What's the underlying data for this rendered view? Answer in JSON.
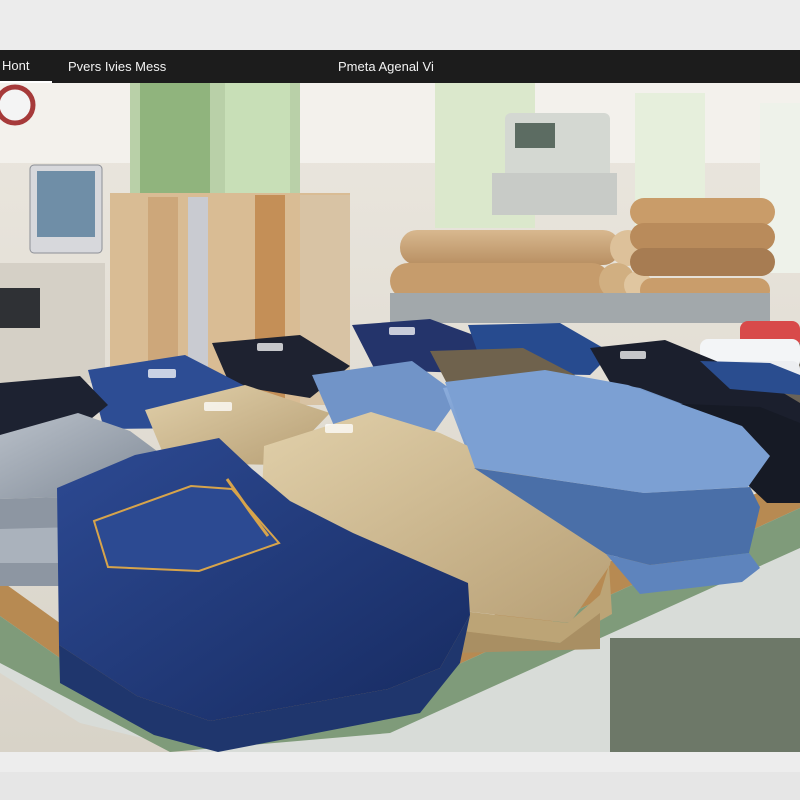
{
  "toolbar": {
    "tabs": [
      {
        "label": "Hont"
      },
      {
        "label": "Pvers Ivies Mess"
      },
      {
        "label": "Pmeta Agenal  Vi"
      }
    ]
  },
  "photo": {
    "description_name": "denim-and-chino-stacks-on-factory-table"
  },
  "colors": {
    "toolbar_bg": "#1c1c1c",
    "dark_denim": "#1f3470",
    "light_denim": "#5f86bc",
    "khaki": "#c8b690",
    "table_wood": "#b78a52"
  }
}
